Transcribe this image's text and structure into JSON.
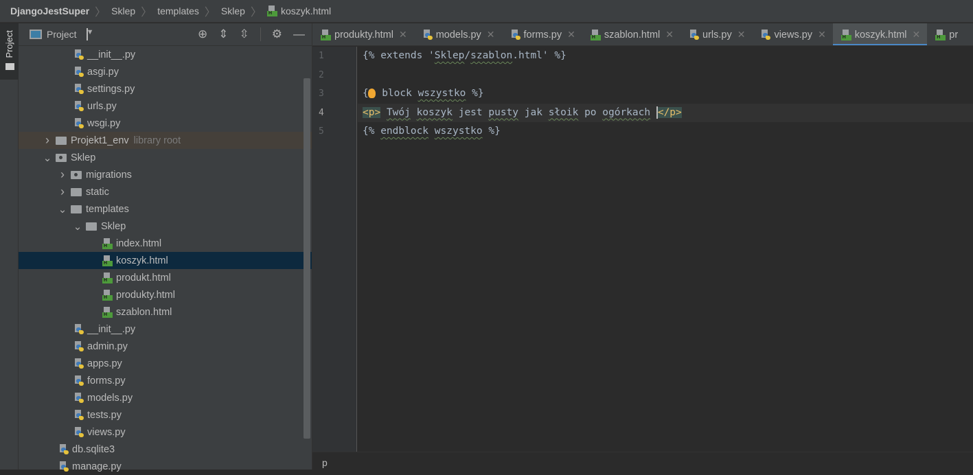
{
  "breadcrumb": [
    "DjangoJestSuper",
    "Sklep",
    "templates",
    "Sklep",
    "koszyk.html"
  ],
  "side_strip": {
    "label": "Project"
  },
  "panel": {
    "title": "Project"
  },
  "tree": [
    {
      "label": "__init__.py",
      "type": "py",
      "level": 3
    },
    {
      "label": "asgi.py",
      "type": "py",
      "level": 3
    },
    {
      "label": "settings.py",
      "type": "py",
      "level": 3
    },
    {
      "label": "urls.py",
      "type": "py",
      "level": 3
    },
    {
      "label": "wsgi.py",
      "type": "py",
      "level": 3
    },
    {
      "label": "Projekt1_env",
      "type": "folder",
      "level": 1,
      "arrow": "collapsed",
      "note": "library root"
    },
    {
      "label": "Sklep",
      "type": "folder-dot",
      "level": 1,
      "arrow": "expanded"
    },
    {
      "label": "migrations",
      "type": "folder-dot",
      "level": 2,
      "arrow": "collapsed"
    },
    {
      "label": "static",
      "type": "folder",
      "level": 2,
      "arrow": "collapsed"
    },
    {
      "label": "templates",
      "type": "folder",
      "level": 2,
      "arrow": "expanded"
    },
    {
      "label": "Sklep",
      "type": "folder",
      "level": 3,
      "arrow": "expanded"
    },
    {
      "label": "index.html",
      "type": "html",
      "level": 5
    },
    {
      "label": "koszyk.html",
      "type": "html",
      "level": 5,
      "selected": true
    },
    {
      "label": "produkt.html",
      "type": "html",
      "level": 5
    },
    {
      "label": "produkty.html",
      "type": "html",
      "level": 5
    },
    {
      "label": "szablon.html",
      "type": "html",
      "level": 5
    },
    {
      "label": "__init__.py",
      "type": "py",
      "level": 3
    },
    {
      "label": "admin.py",
      "type": "py",
      "level": 3
    },
    {
      "label": "apps.py",
      "type": "py",
      "level": 3
    },
    {
      "label": "forms.py",
      "type": "py",
      "level": 3
    },
    {
      "label": "models.py",
      "type": "py",
      "level": 3
    },
    {
      "label": "tests.py",
      "type": "py",
      "level": 3
    },
    {
      "label": "views.py",
      "type": "py",
      "level": 3
    },
    {
      "label": "db.sqlite3",
      "type": "file",
      "level": 2
    },
    {
      "label": "manage.py",
      "type": "py",
      "level": 2
    }
  ],
  "tabs": [
    {
      "label": "produkty.html",
      "type": "html"
    },
    {
      "label": "models.py",
      "type": "py"
    },
    {
      "label": "forms.py",
      "type": "py"
    },
    {
      "label": "szablon.html",
      "type": "html"
    },
    {
      "label": "urls.py",
      "type": "py"
    },
    {
      "label": "views.py",
      "type": "py"
    },
    {
      "label": "koszyk.html",
      "type": "html",
      "active": true
    },
    {
      "label": "pr",
      "type": "html"
    }
  ],
  "code": {
    "line_numbers": [
      "1",
      "2",
      "3",
      "4",
      "5"
    ],
    "l1": {
      "a": "{% extends '",
      "b": "Sklep",
      "c": "/",
      "d": "szablon",
      "e": ".html' %}"
    },
    "l3": {
      "a": "{%",
      "b": " block ",
      "c": "wszystko",
      " d": "",
      "e": " %}"
    },
    "l4": {
      "open": "<p>",
      "text1": " ",
      "w1": "Twój",
      "w2": " ",
      "w3": "koszyk",
      " s": "",
      "t": " jest ",
      "w4": "pusty",
      "t2": " jak ",
      "w5": "słoik",
      "t3": " po ",
      "w6": "ogórkach",
      "t4": " ",
      "close": "</p>"
    },
    "l5": {
      "a": "{% ",
      "b": "endblock",
      "c": " ",
      "d": "wszystko",
      "e": " %}"
    }
  },
  "status": {
    "tag": "p"
  },
  "colors": {
    "accent": "#4a88c7",
    "selection": "#0d293e",
    "tag": "#e8bf6a"
  }
}
